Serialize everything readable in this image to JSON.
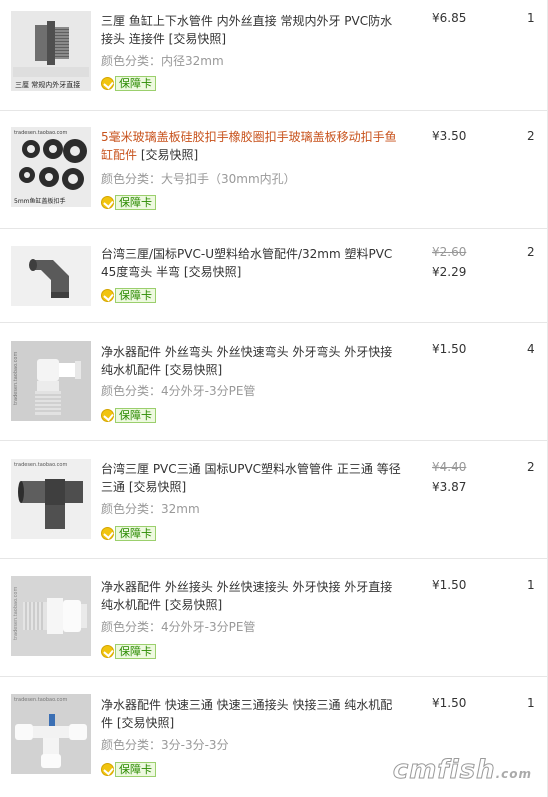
{
  "rows": [
    {
      "title": "三厘 鱼缸上下水管件 内外丝直接 常规内外牙 PVC防水接头 连接件",
      "snapshot": "[交易快照]",
      "attr": "颜色分类：内径32mm",
      "guarantee": "保障卡",
      "price": "¥6.85",
      "old_price": "",
      "qty": "1",
      "thumb_caption": "三厘 常规内外牙直接",
      "orange": false
    },
    {
      "title": "5毫米玻璃盖板硅胶扣手橡胶圈扣手玻璃盖板移动扣手鱼缸配件",
      "snapshot": "[交易快照]",
      "attr": "颜色分类：大号扣手（30mm内孔）",
      "guarantee": "保障卡",
      "price": "¥3.50",
      "old_price": "",
      "qty": "2",
      "thumb_caption": "5mm鱼缸盖板扣手",
      "orange": true
    },
    {
      "title": "台湾三厘/国标PVC-U塑料给水管配件/32mm 塑料PVC 45度弯头 半弯",
      "snapshot": "[交易快照]",
      "attr": "",
      "guarantee": "保障卡",
      "price": "¥2.29",
      "old_price": "¥2.60",
      "qty": "2",
      "thumb_caption": "",
      "orange": false
    },
    {
      "title": "净水器配件 外丝弯头 外丝快速弯头 外牙弯头 外牙快接 纯水机配件",
      "snapshot": "[交易快照]",
      "attr": "颜色分类：4分外牙-3分PE管",
      "guarantee": "保障卡",
      "price": "¥1.50",
      "old_price": "",
      "qty": "4",
      "thumb_caption": "",
      "orange": false
    },
    {
      "title": "台湾三厘 PVC三通 国标UPVC塑料水管管件 正三通 等径三通",
      "snapshot": "[交易快照]",
      "attr": "颜色分类：32mm",
      "guarantee": "保障卡",
      "price": "¥3.87",
      "old_price": "¥4.40",
      "qty": "2",
      "thumb_caption": "",
      "orange": false
    },
    {
      "title": "净水器配件 外丝接头 外丝快速接头 外牙快接 外牙直接 纯水机配件",
      "snapshot": "[交易快照]",
      "attr": "颜色分类：4分外牙-3分PE管",
      "guarantee": "保障卡",
      "price": "¥1.50",
      "old_price": "",
      "qty": "1",
      "thumb_caption": "",
      "orange": false
    },
    {
      "title": "净水器配件 快速三通 快速三通接头 快接三通 纯水机配件",
      "snapshot": "[交易快照]",
      "attr": "颜色分类：3分-3分-3分",
      "guarantee": "保障卡",
      "price": "¥1.50",
      "old_price": "",
      "qty": "1",
      "thumb_caption": "",
      "orange": false
    }
  ],
  "thumb_watermark": "tradesen.taobao.com",
  "site_watermark": "cmfish",
  "site_watermark_suffix": ".com"
}
